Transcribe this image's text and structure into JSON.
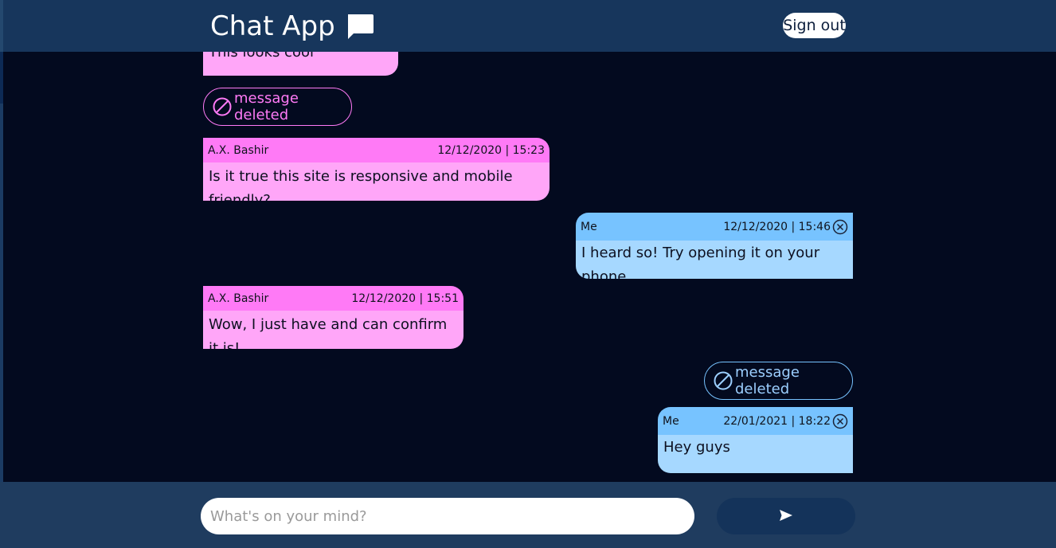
{
  "header": {
    "title": "Chat App",
    "sign_out_label": "Sign out"
  },
  "messages": {
    "m0": {
      "body": "This looks cool"
    },
    "d1": {
      "label": "message deleted"
    },
    "m2": {
      "author": "A.X. Bashir",
      "time": "12/12/2020 | 15:23",
      "body": "Is it true this site is responsive and mobile friendly?"
    },
    "m3": {
      "author": "Me",
      "time": "12/12/2020 | 15:46",
      "body": "I heard so! Try opening it on your phone"
    },
    "m4": {
      "author": "A.X. Bashir",
      "time": "12/12/2020 | 15:51",
      "body": "Wow, I just have and can confirm it is!"
    },
    "d5": {
      "label": "message deleted"
    },
    "m6": {
      "author": "Me",
      "time": "22/01/2021 | 18:22",
      "body": "Hey guys"
    }
  },
  "composer": {
    "placeholder": "What's on your mind?",
    "send_icon": "send-icon"
  },
  "colors": {
    "header_bg": "#17365c",
    "chat_bg": "#030a1f",
    "their_meta": "#ff7af6",
    "their_body": "#ffa6f8",
    "my_meta": "#77c3ff",
    "my_body": "#a6d8ff"
  }
}
